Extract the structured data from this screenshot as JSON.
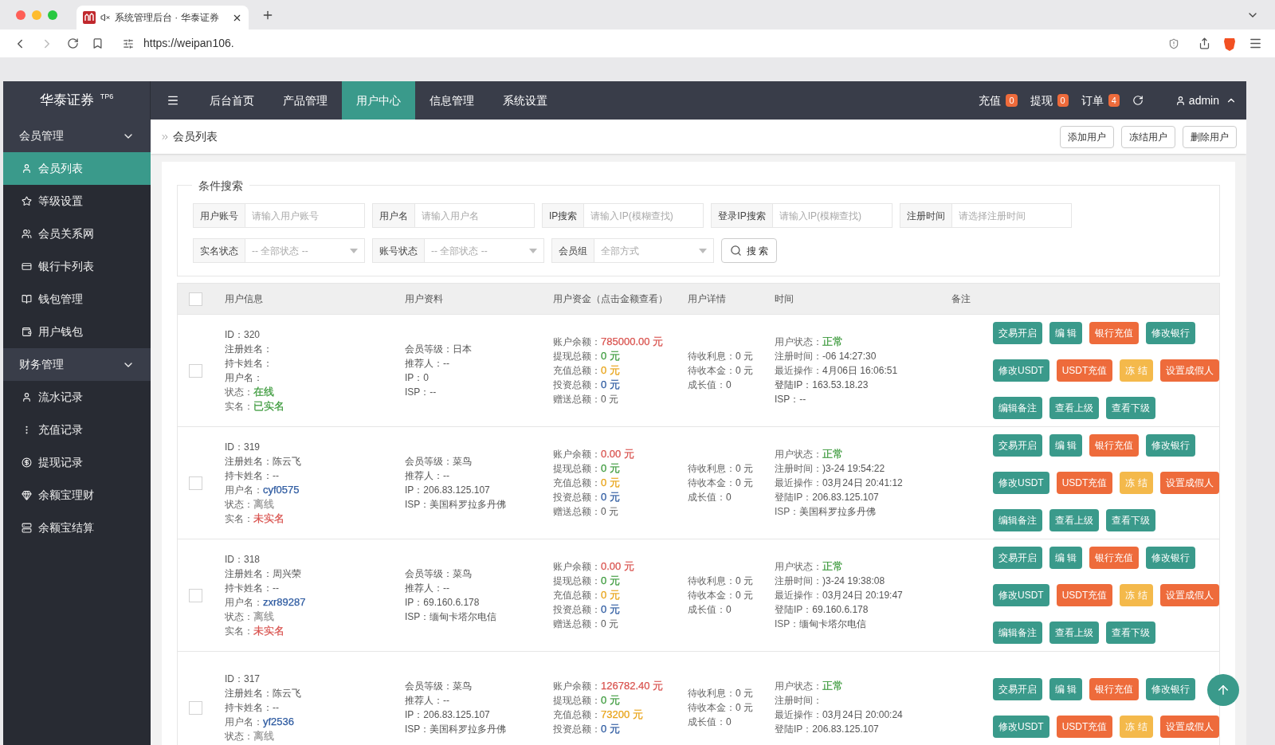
{
  "browser": {
    "tab_title": "系统管理后台 · 华泰证券",
    "url": "https://weipan106."
  },
  "header": {
    "logo": "华泰证券",
    "logo_sup": "TP6",
    "nav": [
      {
        "label": "后台首页",
        "selected": false
      },
      {
        "label": "产品管理",
        "selected": false
      },
      {
        "label": "用户中心",
        "selected": true
      },
      {
        "label": "信息管理",
        "selected": false
      },
      {
        "label": "系统设置",
        "selected": false
      }
    ],
    "counters": [
      {
        "label": "充值",
        "count": "0"
      },
      {
        "label": "提现",
        "count": "0"
      },
      {
        "label": "订单",
        "count": "4"
      }
    ],
    "user": "admin"
  },
  "sidebar": [
    {
      "label": "会员管理",
      "expanded": true,
      "items": [
        {
          "label": "会员列表",
          "selected": true
        },
        {
          "label": "等级设置",
          "selected": false
        },
        {
          "label": "会员关系网",
          "selected": false
        },
        {
          "label": "银行卡列表",
          "selected": false
        },
        {
          "label": "钱包管理",
          "selected": false
        },
        {
          "label": "用户钱包",
          "selected": false
        }
      ]
    },
    {
      "label": "财务管理",
      "expanded": true,
      "items": [
        {
          "label": "流水记录",
          "selected": false
        },
        {
          "label": "充值记录",
          "selected": false
        },
        {
          "label": "提现记录",
          "selected": false
        },
        {
          "label": "余额宝理财",
          "selected": false
        },
        {
          "label": "余额宝结算",
          "selected": false
        }
      ]
    }
  ],
  "breadcrumb": "会员列表",
  "page_actions": [
    "添加用户",
    "冻结用户",
    "删除用户"
  ],
  "search": {
    "legend": "条件搜索",
    "rows": [
      [
        {
          "kind": "input",
          "label": "用户账号",
          "placeholder": "请输入用户账号"
        },
        {
          "kind": "input",
          "label": "用户名",
          "placeholder": "请输入用户名"
        },
        {
          "kind": "input",
          "label": "IP搜索",
          "placeholder": "请输入IP(模糊查找)"
        },
        {
          "kind": "input",
          "label": "登录IP搜索",
          "placeholder": "请输入IP(模糊查找)"
        },
        {
          "kind": "input",
          "label": "注册时间",
          "placeholder": "请选择注册时间"
        }
      ],
      [
        {
          "kind": "select",
          "label": "实名状态",
          "placeholder": "-- 全部状态 --"
        },
        {
          "kind": "select",
          "label": "账号状态",
          "placeholder": "-- 全部状态 --"
        },
        {
          "kind": "select",
          "label": "会员组",
          "placeholder": "全部方式"
        }
      ]
    ],
    "button": "搜 索"
  },
  "table": {
    "header_checked": false,
    "columns": [
      "用户信息",
      "用户资料",
      "用户资金（点击金额查看）",
      "用户详情",
      "时间",
      "备注"
    ],
    "rows": [
      {
        "checked": false,
        "info": [
          {
            "text": "ID：320"
          },
          {
            "text": "注册姓名："
          },
          {
            "text": "持卡姓名："
          },
          {
            "text": "用户名："
          },
          {
            "label": "状态：",
            "value": "在线",
            "color": "#3c9a3c"
          },
          {
            "label": "实名：",
            "value": "已实名",
            "color": "#3c9a3c"
          }
        ],
        "profile": [
          {
            "text": "会员等级：日本"
          },
          {
            "text": "推荐人：--"
          },
          {
            "text": "IP：0"
          },
          {
            "text": "ISP：--"
          }
        ],
        "funds": [
          {
            "label": "账户余额：",
            "value": "785000.00 元",
            "color": "#d9534f"
          },
          {
            "label": "提现总额：",
            "value": "0 元",
            "color": "#3c9a3c"
          },
          {
            "label": "充值总额：",
            "value": "0 元",
            "color": "#e8a317"
          },
          {
            "label": "投资总额：",
            "value": "0 元",
            "color": "#2d5aa0"
          },
          {
            "label": "赠送总额：",
            "value": "0 元"
          }
        ],
        "details": [
          {
            "label": "待收利息：",
            "value": "0 元"
          },
          {
            "label": "待收本金：",
            "value": "0 元"
          },
          {
            "label": "成长值：",
            "value": "0"
          }
        ],
        "time": [
          {
            "label": "用户状态：",
            "value": "正常",
            "color": "#3c9a3c"
          },
          {
            "label": "注册时间：",
            "value": "-06 14:27:30"
          },
          {
            "label": "最近操作：",
            "value": "4月06日 16:06:51"
          },
          {
            "text": "登陆IP：163.53.18.23"
          },
          {
            "text": "ISP：--"
          }
        ],
        "actions": [
          [
            {
              "label": "交易开启",
              "color": "#3a9a8b"
            },
            {
              "label": "编 辑",
              "color": "#3a9a8b"
            },
            {
              "label": "银行充值",
              "color": "#ee6b3b"
            },
            {
              "label": "修改银行",
              "color": "#3a9a8b"
            }
          ],
          [
            {
              "label": "修改USDT",
              "color": "#3a9a8b"
            },
            {
              "label": "USDT充值",
              "color": "#ee6b3b"
            },
            {
              "label": "冻 结",
              "color": "#f4b94b"
            },
            {
              "label": "设置成假人",
              "color": "#ee6b3b"
            }
          ],
          [
            {
              "label": "编辑备注",
              "color": "#3a9a8b"
            },
            {
              "label": "查看上级",
              "color": "#3a9a8b"
            },
            {
              "label": "查看下级",
              "color": "#3a9a8b"
            }
          ]
        ]
      },
      {
        "checked": false,
        "info": [
          {
            "text": "ID：319"
          },
          {
            "text": "注册姓名：陈云飞"
          },
          {
            "text": "持卡姓名：--"
          },
          {
            "label": "用户名：",
            "value": "cyf0575",
            "color": "#2d5aa0"
          },
          {
            "label": "状态：",
            "value": "离线",
            "color": "#999999"
          },
          {
            "label": "实名：",
            "value": "未实名",
            "color": "#d9534f"
          }
        ],
        "profile": [
          {
            "text": "会员等级：菜鸟"
          },
          {
            "text": "推荐人：--"
          },
          {
            "text": "IP：206.83.125.107"
          },
          {
            "text": "ISP：美国科罗拉多丹佛"
          }
        ],
        "funds": [
          {
            "label": "账户余额：",
            "value": "0.00 元",
            "color": "#d9534f"
          },
          {
            "label": "提现总额：",
            "value": "0 元",
            "color": "#3c9a3c"
          },
          {
            "label": "充值总额：",
            "value": "0 元",
            "color": "#e8a317"
          },
          {
            "label": "投资总额：",
            "value": "0 元",
            "color": "#2d5aa0"
          },
          {
            "label": "赠送总额：",
            "value": "0 元"
          }
        ],
        "details": [
          {
            "label": "待收利息：",
            "value": "0 元"
          },
          {
            "label": "待收本金：",
            "value": "0 元"
          },
          {
            "label": "成长值：",
            "value": "0"
          }
        ],
        "time": [
          {
            "label": "用户状态：",
            "value": "正常",
            "color": "#3c9a3c"
          },
          {
            "label": "注册时间：",
            "value": ")3-24 19:54:22"
          },
          {
            "label": "最近操作：",
            "value": "03月24日 20:41:12"
          },
          {
            "label": "登陆IP：",
            "value": "206.83.125.107"
          },
          {
            "label": "ISP：",
            "value": "美国科罗拉多丹佛"
          }
        ],
        "actions": [
          [
            {
              "label": "交易开启",
              "color": "#3a9a8b"
            },
            {
              "label": "编 辑",
              "color": "#3a9a8b"
            },
            {
              "label": "银行充值",
              "color": "#ee6b3b"
            },
            {
              "label": "修改银行",
              "color": "#3a9a8b"
            }
          ],
          [
            {
              "label": "修改USDT",
              "color": "#3a9a8b"
            },
            {
              "label": "USDT充值",
              "color": "#ee6b3b"
            },
            {
              "label": "冻 结",
              "color": "#f4b94b"
            },
            {
              "label": "设置成假人",
              "color": "#ee6b3b"
            }
          ],
          [
            {
              "label": "编辑备注",
              "color": "#3a9a8b"
            },
            {
              "label": "查看上级",
              "color": "#3a9a8b"
            },
            {
              "label": "查看下级",
              "color": "#3a9a8b"
            }
          ]
        ]
      },
      {
        "checked": false,
        "info": [
          {
            "text": "ID：318"
          },
          {
            "text": "注册姓名：周兴荣"
          },
          {
            "text": "持卡姓名：--"
          },
          {
            "label": "用户名：",
            "value": "zxr89287",
            "color": "#2d5aa0"
          },
          {
            "label": "状态：",
            "value": "离线",
            "color": "#999999"
          },
          {
            "label": "实名：",
            "value": "未实名",
            "color": "#d9534f"
          }
        ],
        "profile": [
          {
            "text": "会员等级：菜鸟"
          },
          {
            "text": "推荐人：--"
          },
          {
            "text": "IP：69.160.6.178"
          },
          {
            "text": "ISP：缅甸卡塔尔电信"
          }
        ],
        "funds": [
          {
            "label": "账户余额：",
            "value": "0.00 元",
            "color": "#d9534f"
          },
          {
            "label": "提现总额：",
            "value": "0 元",
            "color": "#3c9a3c"
          },
          {
            "label": "充值总额：",
            "value": "0 元",
            "color": "#e8a317"
          },
          {
            "label": "投资总额：",
            "value": "0 元",
            "color": "#2d5aa0"
          },
          {
            "label": "赠送总额：",
            "value": "0 元"
          }
        ],
        "details": [
          {
            "label": "待收利息：",
            "value": "0 元"
          },
          {
            "label": "待收本金：",
            "value": "0 元"
          },
          {
            "label": "成长值：",
            "value": "0"
          }
        ],
        "time": [
          {
            "label": "用户状态：",
            "value": "正常",
            "color": "#3c9a3c"
          },
          {
            "label": "注册时间：",
            "value": ")3-24 19:38:08"
          },
          {
            "label": "最近操作：",
            "value": "03月24日 20:19:47"
          },
          {
            "label": "登陆IP：",
            "value": "69.160.6.178"
          },
          {
            "label": "ISP：",
            "value": "缅甸卡塔尔电信"
          }
        ],
        "actions": [
          [
            {
              "label": "交易开启",
              "color": "#3a9a8b"
            },
            {
              "label": "编 辑",
              "color": "#3a9a8b"
            },
            {
              "label": "银行充值",
              "color": "#ee6b3b"
            },
            {
              "label": "修改银行",
              "color": "#3a9a8b"
            }
          ],
          [
            {
              "label": "修改USDT",
              "color": "#3a9a8b"
            },
            {
              "label": "USDT充值",
              "color": "#ee6b3b"
            },
            {
              "label": "冻 结",
              "color": "#f4b94b"
            },
            {
              "label": "设置成假人",
              "color": "#ee6b3b"
            }
          ],
          [
            {
              "label": "编辑备注",
              "color": "#3a9a8b"
            },
            {
              "label": "查看上级",
              "color": "#3a9a8b"
            },
            {
              "label": "查看下级",
              "color": "#3a9a8b"
            }
          ]
        ]
      },
      {
        "checked": false,
        "info": [
          {
            "text": "ID：317"
          },
          {
            "text": "注册姓名：陈云飞"
          },
          {
            "text": "持卡姓名：--"
          },
          {
            "label": "用户名：",
            "value": "yf2536",
            "color": "#2d5aa0"
          },
          {
            "label": "状态：",
            "value": "离线",
            "color": "#999999"
          }
        ],
        "profile": [
          {
            "text": "会员等级：菜鸟"
          },
          {
            "text": "推荐人：--"
          },
          {
            "text": "IP：206.83.125.107"
          },
          {
            "text": "ISP：美国科罗拉多丹佛"
          }
        ],
        "funds": [
          {
            "label": "账户余额：",
            "value": "126782.40 元",
            "color": "#d9534f"
          },
          {
            "label": "提现总额：",
            "value": "0 元",
            "color": "#3c9a3c"
          },
          {
            "label": "充值总额：",
            "value": "73200 元",
            "color": "#e8a317"
          },
          {
            "label": "投资总额：",
            "value": "0 元",
            "color": "#2d5aa0"
          }
        ],
        "details": [
          {
            "label": "待收利息：",
            "value": "0 元"
          },
          {
            "label": "待收本金：",
            "value": "0 元"
          },
          {
            "label": "成长值：",
            "value": "0"
          }
        ],
        "time": [
          {
            "label": "用户状态：",
            "value": "正常",
            "color": "#3c9a3c"
          },
          {
            "label": "注册时间："
          },
          {
            "label": "最近操作：",
            "value": "03月24日 20:00:24"
          },
          {
            "label": "登陆IP：",
            "value": "206.83.125.107"
          }
        ],
        "actions": [
          [
            {
              "label": "交易开启",
              "color": "#3a9a8b"
            },
            {
              "label": "编 辑",
              "color": "#3a9a8b"
            },
            {
              "label": "银行充值",
              "color": "#ee6b3b"
            },
            {
              "label": "修改银行",
              "color": "#3a9a8b"
            }
          ],
          [
            {
              "label": "修改USDT",
              "color": "#3a9a8b"
            },
            {
              "label": "USDT充值",
              "color": "#ee6b3b"
            },
            {
              "label": "冻 结",
              "color": "#f4b94b"
            },
            {
              "label": "设置成假人",
              "color": "#ee6b3b"
            }
          ]
        ]
      }
    ]
  }
}
